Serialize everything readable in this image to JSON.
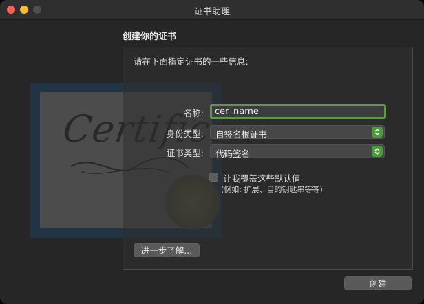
{
  "window": {
    "title": "证书助理"
  },
  "illustration": {
    "word": "Certificate"
  },
  "page": {
    "heading": "创建你的证书",
    "instruction": "请在下面指定证书的一些信息:"
  },
  "form": {
    "name_label": "名称:",
    "name_value": "cer_name",
    "identity_label": "身份类型:",
    "identity_value": "自签名根证书",
    "cert_type_label": "证书类型:",
    "cert_type_value": "代码签名",
    "override_label": "让我覆盖这些默认值",
    "override_hint": "(例如: 扩展、目的钥匙串等等)",
    "override_checked": false
  },
  "buttons": {
    "learn_more": "进一步了解...",
    "create": "创建"
  },
  "colors": {
    "accent_green": "#4c9a3d",
    "close": "#fe5f57",
    "minimize": "#febc2e"
  }
}
